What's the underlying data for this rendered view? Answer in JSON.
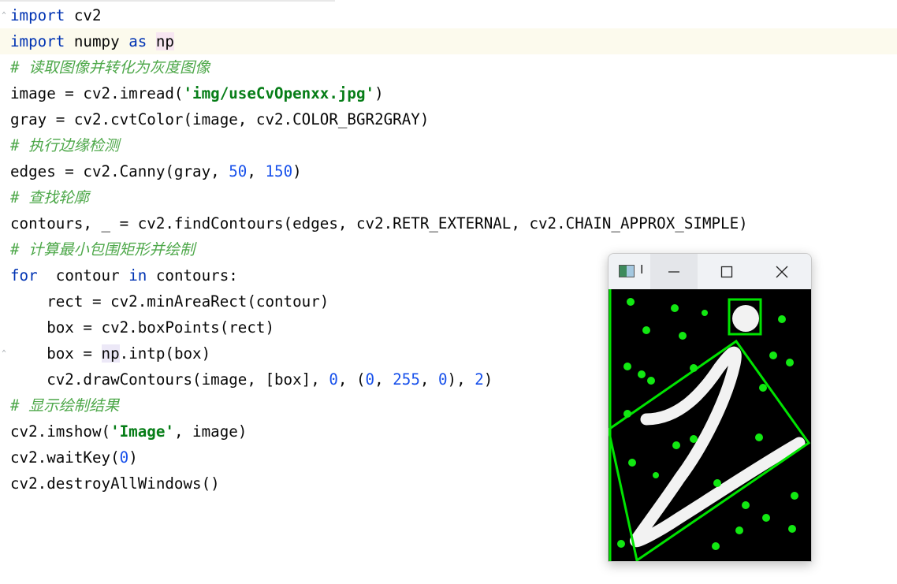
{
  "code_lines": [
    {
      "parts": [
        [
          "kw",
          "import"
        ],
        [
          "",
          "cv2"
        ]
      ]
    },
    {
      "parts": [
        [
          "kw",
          "import"
        ],
        [
          "",
          "numpy"
        ],
        [
          "kw",
          "as"
        ],
        [
          "np-hl",
          "np"
        ]
      ]
    },
    {
      "parts": [
        [
          "cm-green",
          "# 读取图像并转化为灰度图像"
        ]
      ]
    },
    {
      "parts": [
        [
          "",
          "image = cv2.imread("
        ],
        [
          "str",
          "'img/useCvOpenxx.jpg'"
        ],
        [
          "",
          ")"
        ]
      ]
    },
    {
      "parts": [
        [
          "",
          "gray = cv2.cvtColor(image, cv2.COLOR_BGR2GRAY)"
        ]
      ]
    },
    {
      "parts": [
        [
          "cm-green",
          "# 执行边缘检测"
        ]
      ]
    },
    {
      "parts": [
        [
          "",
          "edges = cv2.Canny(gray, "
        ],
        [
          "num",
          "50"
        ],
        [
          "",
          ", "
        ],
        [
          "num",
          "150"
        ],
        [
          "",
          ")"
        ]
      ]
    },
    {
      "parts": [
        [
          "cm-green",
          "# 查找轮廓"
        ]
      ]
    },
    {
      "parts": [
        [
          "",
          "contours, _ = cv2.findContours(edges, cv2.RETR_EXTERNAL, cv2.CHAIN_APPROX_SIMPLE)"
        ]
      ]
    },
    {
      "parts": [
        [
          "cm-green",
          "# 计算最小包围矩形并绘制"
        ]
      ]
    },
    {
      "parts": [
        [
          "kw",
          "for"
        ],
        [
          "",
          " contour "
        ],
        [
          "kw",
          "in"
        ],
        [
          "",
          " contours:"
        ]
      ]
    },
    {
      "parts": [
        [
          "",
          "    rect = cv2.minAreaRect(contour)"
        ]
      ]
    },
    {
      "parts": [
        [
          "",
          "    box = cv2.boxPoints(rect)"
        ]
      ]
    },
    {
      "parts": [
        [
          "",
          "    box = "
        ],
        [
          "np-hl2",
          "np"
        ],
        [
          "",
          ".intp(box)"
        ]
      ]
    },
    {
      "parts": [
        [
          "",
          "    cv2.drawContours(image, [box], "
        ],
        [
          "num",
          "0"
        ],
        [
          "",
          ", ("
        ],
        [
          "num",
          "0"
        ],
        [
          "",
          ", "
        ],
        [
          "num",
          "255"
        ],
        [
          "",
          ", "
        ],
        [
          "num",
          "0"
        ],
        [
          "",
          "), "
        ],
        [
          "num",
          "2"
        ],
        [
          "",
          ")"
        ]
      ]
    },
    {
      "parts": [
        [
          "cm-green",
          "# 显示绘制结果"
        ]
      ]
    },
    {
      "parts": [
        [
          "",
          "cv2.imshow("
        ],
        [
          "str",
          "'Image'"
        ],
        [
          "",
          ", image)"
        ]
      ]
    },
    {
      "parts": [
        [
          "",
          "cv2.waitKey("
        ],
        [
          "num",
          "0"
        ],
        [
          "",
          ")"
        ]
      ]
    },
    {
      "parts": [
        [
          "",
          "cv2.destroyAllWindows()"
        ]
      ]
    }
  ],
  "window": {
    "title": "I",
    "icons": {
      "app": "app-window-icon",
      "min": "minimize-icon",
      "max": "maximize-icon",
      "close": "close-icon"
    }
  },
  "colors": {
    "keyword": "#0033b3",
    "comment": "#4ea84a",
    "string": "#067d17",
    "number": "#1750eb",
    "drawn_box": "#00ff00"
  }
}
